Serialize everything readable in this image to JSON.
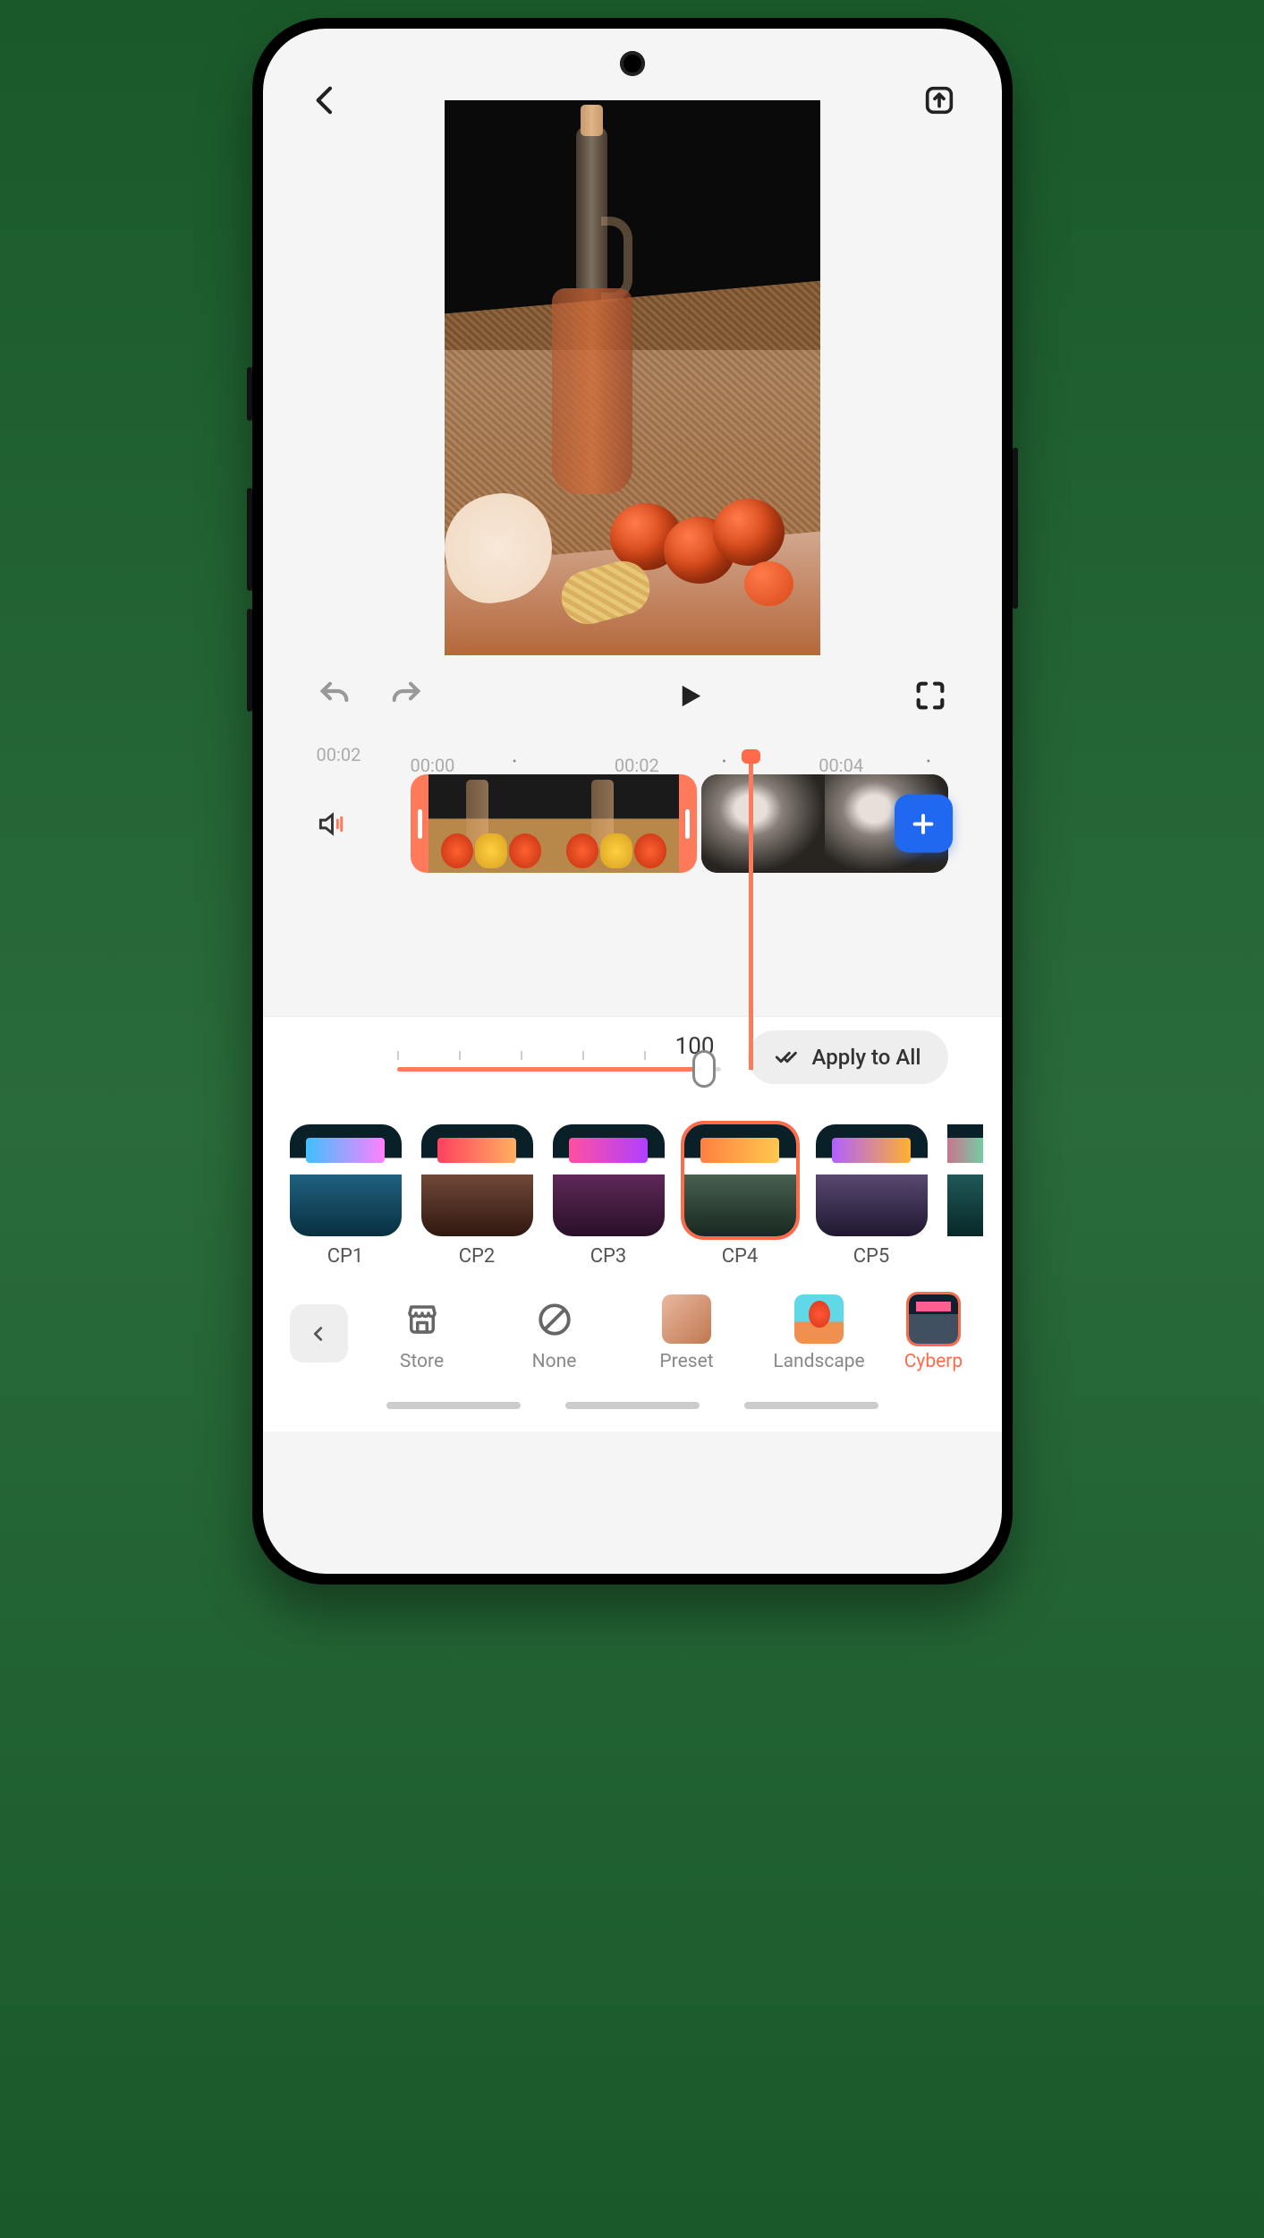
{
  "header": {
    "back_icon": "back",
    "export_icon": "export"
  },
  "playback": {
    "undo_icon": "undo",
    "redo_icon": "redo",
    "play_icon": "play",
    "fullscreen_icon": "fullscreen"
  },
  "timeline": {
    "current_time": "00:02",
    "marks": [
      "00:00",
      "00:02",
      "00:04"
    ],
    "audio_icon": "speaker",
    "add_icon": "plus",
    "playhead_position": 0.42
  },
  "slider": {
    "value": "100",
    "apply_label": "Apply to All"
  },
  "filters": [
    {
      "id": "cp1",
      "label": "CP1",
      "selected": false
    },
    {
      "id": "cp2",
      "label": "CP2",
      "selected": false
    },
    {
      "id": "cp3",
      "label": "CP3",
      "selected": false
    },
    {
      "id": "cp4",
      "label": "CP4",
      "selected": true
    },
    {
      "id": "cp5",
      "label": "CP5",
      "selected": false
    },
    {
      "id": "cp6",
      "label": "",
      "selected": false
    }
  ],
  "categories": {
    "back_icon": "chevron-left",
    "items": [
      {
        "id": "store",
        "label": "Store",
        "type": "icon",
        "active": false
      },
      {
        "id": "none",
        "label": "None",
        "type": "icon",
        "active": false
      },
      {
        "id": "preset",
        "label": "Preset",
        "type": "thumb",
        "active": false
      },
      {
        "id": "landscape",
        "label": "Landscape",
        "type": "thumb",
        "active": false
      },
      {
        "id": "cyberpunk",
        "label": "Cyberp",
        "type": "thumb",
        "active": true
      }
    ]
  }
}
